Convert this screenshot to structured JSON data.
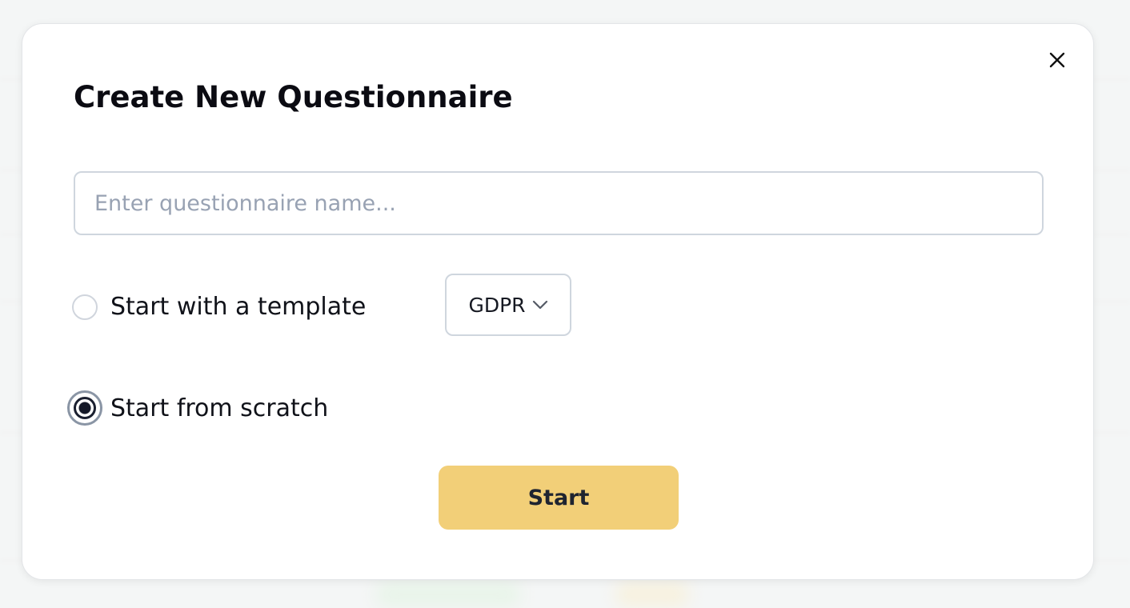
{
  "dialog": {
    "title": "Create New Questionnaire",
    "name_input": {
      "placeholder": "Enter questionnaire name...",
      "value": ""
    },
    "options": [
      {
        "label": "Start with a template",
        "selected": false
      },
      {
        "label": "Start from scratch",
        "selected": true
      }
    ],
    "template_select": {
      "selected": "GDPR"
    },
    "start_button": "Start"
  },
  "icons": {
    "close": "close-icon",
    "dropdown": "chevron-down-icon"
  },
  "colors": {
    "primary_button": "#f2cf78",
    "input_border": "#cfd6de",
    "placeholder": "#98a2b3",
    "text": "#0b0b12"
  }
}
